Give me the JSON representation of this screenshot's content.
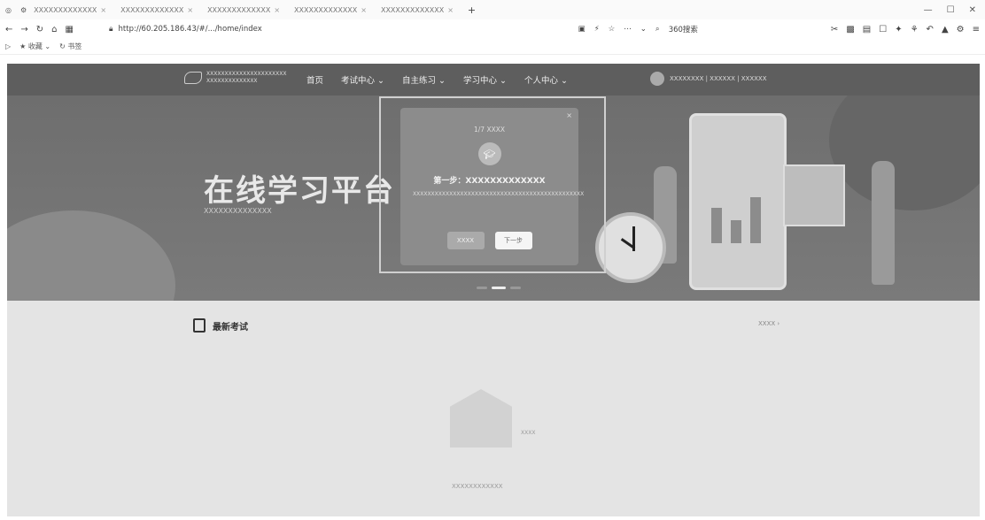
{
  "browser": {
    "tabs": [
      {
        "label": "ХХХХХХХХХХХХХ"
      },
      {
        "label": "ХХХХХХХХХХХХХ"
      },
      {
        "label": "ХХХХХХХХХХХХХ"
      },
      {
        "label": "ХХХХХХХХХХХХХ"
      },
      {
        "label": "ХХХХХХХХХХХХХ"
      }
    ],
    "new_tab": "+",
    "url": "http://60.205.186.43/#/.../home/index",
    "search_engine": "360搜索",
    "bookmark": "收藏",
    "bookmark2": "书签"
  },
  "site": {
    "logo_line1": "XXXXXXXXXXXXXXXXXXXXXX",
    "logo_line2": "XXXXXXXXXXXXXX",
    "nav": [
      {
        "label": "首页"
      },
      {
        "label": "考试中心 ⌄"
      },
      {
        "label": "自主练习 ⌄"
      },
      {
        "label": "学习中心 ⌄"
      },
      {
        "label": "个人中心 ⌄"
      }
    ],
    "user_text": "XXXXXXXX  |  XXXXXX  |  XXXXXX"
  },
  "banner": {
    "title": "在线学习平台",
    "subtitle": "XXXXXXXXXXXXXX"
  },
  "guide_modal": {
    "step": "1/7 XXXX",
    "title": "第一步：XXXXXXXXXXXXX",
    "description": "XXXXXXXXXXXXXXXXXXXXXXXXXXXXXXXXXXXXXXXXXXXXXXX",
    "skip_label": "XXXX",
    "next_label": "下一步",
    "close": "×"
  },
  "section": {
    "title": "最新考试",
    "more": "XXXX ›",
    "empty_badge": "XXXX",
    "empty_text": "XXXXXXXXXXXX"
  },
  "colors": {
    "header_bg": "#5e5e5e",
    "banner_bg": "#707070",
    "modal_bg": "#8c8c8c",
    "content_bg": "#e4e4e4"
  }
}
